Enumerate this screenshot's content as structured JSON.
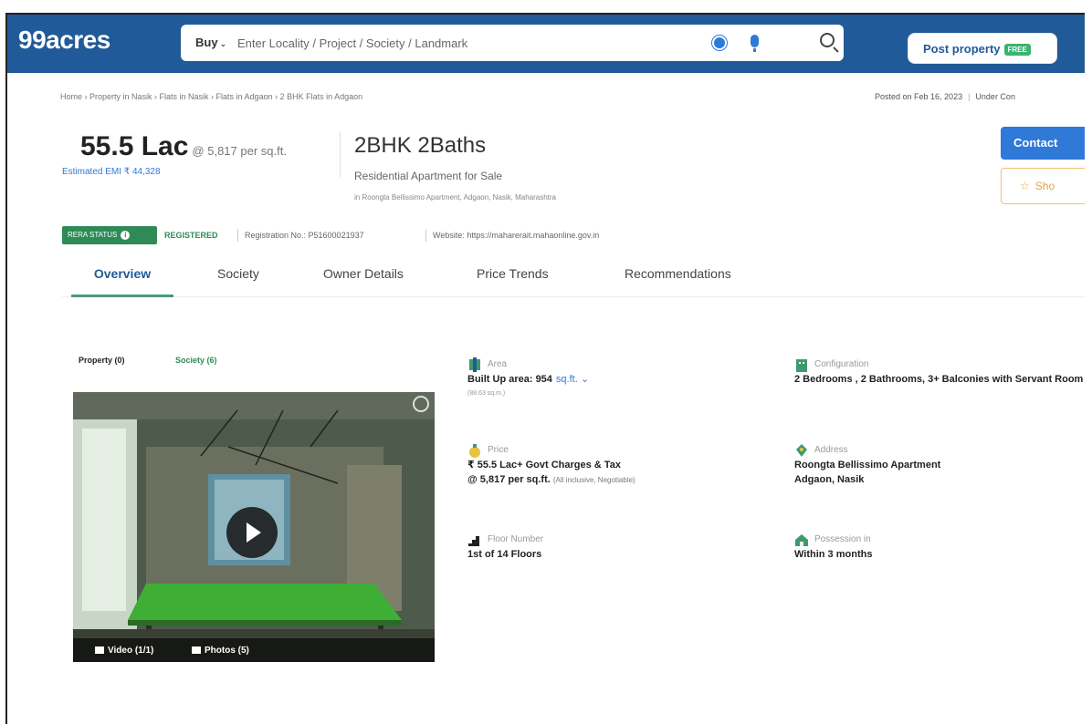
{
  "header": {
    "logo": "99acres",
    "buy_label": "Buy",
    "search_placeholder": "Enter Locality / Project / Society / Landmark",
    "post_label": "Post property",
    "free_badge": "FREE"
  },
  "breadcrumb": "Home › Property in Nasik › Flats in Nasik › Flats in Adgaon › 2 BHK Flats in Adgaon",
  "posted": "Posted on Feb 16, 2023",
  "status": "Under Con",
  "listing": {
    "price": "55.5 Lac",
    "rate": "@ 5,817 per sq.ft.",
    "emi": "Estimated EMI ₹ 44,328",
    "title": "2BHK 2Baths",
    "subtitle": "Residential Apartment for Sale",
    "address_line": "in Roongta Bellissimo Apartment, Adgaon, Nasik, Maharashtra"
  },
  "actions": {
    "contact": "Contact",
    "shortlist": "Sho"
  },
  "rera": {
    "badge": "RERA STATUS",
    "status": "REGISTERED",
    "registration": "Registration No.: P51600021937",
    "website": "Website: https://maharerait.mahaonline.gov.in"
  },
  "tabs": [
    "Overview",
    "Society",
    "Owner Details",
    "Price Trends",
    "Recommendations"
  ],
  "media_tabs": [
    "Property (0)",
    "Society (6)"
  ],
  "media": {
    "video": "Video (1/1)",
    "photos": "Photos (5)"
  },
  "details": {
    "area": {
      "label": "Area",
      "value": "Built Up area: 954",
      "unit": "sq.ft.",
      "sub": "(88.63 sq.m.)"
    },
    "configuration": {
      "label": "Configuration",
      "value": "2 Bedrooms , 2 Bathrooms, 3+ Balconies with Servant Room"
    },
    "price": {
      "label": "Price",
      "value": "₹ 55.5 Lac+ Govt Charges & Tax",
      "rate": "@ 5,817 per sq.ft.",
      "note": "(All inclusive, Negotiable)"
    },
    "address": {
      "label": "Address",
      "line1": "Roongta Bellissimo Apartment",
      "line2": "Adgaon, Nasik"
    },
    "floor": {
      "label": "Floor Number",
      "value": "1st of 14 Floors"
    },
    "possession": {
      "label": "Possession in",
      "value": "Within 3 months"
    }
  },
  "colors": {
    "header_bg": "#215a98",
    "accent_blue": "#2f79d8",
    "rera_green": "#2e8b57"
  }
}
